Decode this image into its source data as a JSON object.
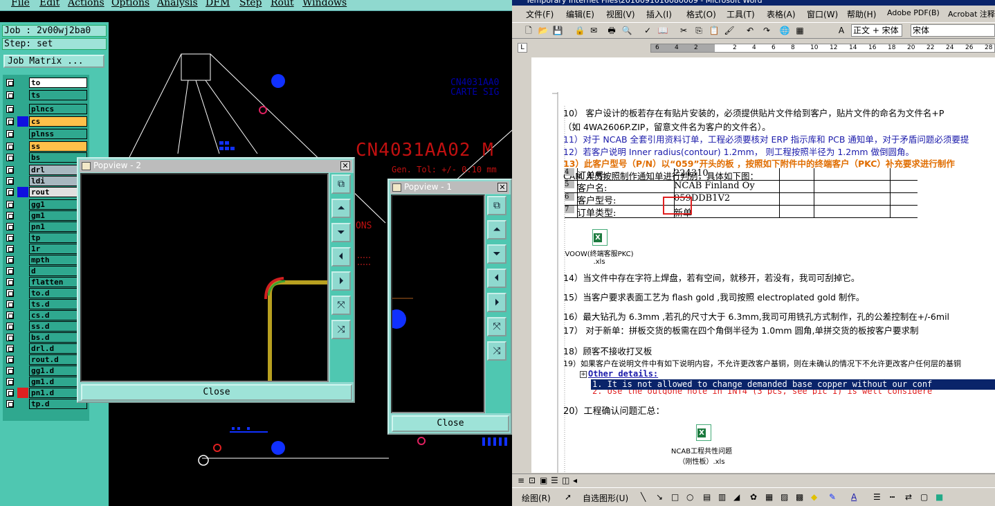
{
  "cam": {
    "menu": [
      "File",
      "Edit",
      "Actions",
      "Options",
      "Analysis",
      "DFM",
      "Step",
      "Rout",
      "Windows"
    ],
    "job": "Job : 2v00wj2ba0",
    "step": "Step: set",
    "job_matrix": "Job Matrix ...",
    "layers": [
      {
        "name": "to",
        "color": "#2fa88f",
        "fill": "#ffffff"
      },
      {
        "name": "ts",
        "color": "#2fa88f",
        "fill": "#2fa88f"
      },
      {
        "name": "plncs",
        "color": "#2fa88f",
        "fill": "#2fa88f"
      },
      {
        "name": "cs",
        "color": "#1010e0",
        "fill": "#ffc04a"
      },
      {
        "name": "plnss",
        "color": "#2fa88f",
        "fill": "#2fa88f"
      },
      {
        "name": "ss",
        "color": "#2fa88f",
        "fill": "#ffc04a"
      },
      {
        "name": "bs",
        "color": "#2fa88f",
        "fill": "#2fa88f"
      },
      {
        "name": "drl",
        "color": "#2fa88f",
        "fill": "#a8b8c0"
      },
      {
        "name": "ldi",
        "color": "#2fa88f",
        "fill": "#a8b8c0"
      },
      {
        "name": "rout",
        "color": "#1010e0",
        "fill": "#e0e0e0"
      },
      {
        "name": "gg1",
        "color": "#2fa88f",
        "fill": "#2fa88f"
      },
      {
        "name": "gm1",
        "color": "#2fa88f",
        "fill": "#2fa88f"
      },
      {
        "name": "pn1",
        "color": "#2fa88f",
        "fill": "#2fa88f"
      },
      {
        "name": "tp",
        "color": "#2fa88f",
        "fill": "#2fa88f"
      },
      {
        "name": "1r",
        "color": "#2fa88f",
        "fill": "#2fa88f"
      },
      {
        "name": "mpth",
        "color": "#2fa88f",
        "fill": "#2fa88f"
      },
      {
        "name": "d",
        "color": "#2fa88f",
        "fill": "#2fa88f"
      },
      {
        "name": "flatten",
        "color": "#2fa88f",
        "fill": "#2fa88f"
      },
      {
        "name": "to.d",
        "color": "#2fa88f",
        "fill": "#2fa88f"
      },
      {
        "name": "ts.d",
        "color": "#2fa88f",
        "fill": "#2fa88f"
      },
      {
        "name": "cs.d",
        "color": "#2fa88f",
        "fill": "#2fa88f"
      },
      {
        "name": "ss.d",
        "color": "#2fa88f",
        "fill": "#2fa88f"
      },
      {
        "name": "bs.d",
        "color": "#2fa88f",
        "fill": "#2fa88f"
      },
      {
        "name": "drl.d",
        "color": "#2fa88f",
        "fill": "#2fa88f"
      },
      {
        "name": "rout.d",
        "color": "#2fa88f",
        "fill": "#2fa88f"
      },
      {
        "name": "gg1.d",
        "color": "#2fa88f",
        "fill": "#2fa88f"
      },
      {
        "name": "gm1.d",
        "color": "#2fa88f",
        "fill": "#2fa88f"
      },
      {
        "name": "pn1.d",
        "color": "#e02020",
        "fill": "#2fa88f"
      },
      {
        "name": "tp.d",
        "color": "#2fa88f",
        "fill": "#2fa88f"
      }
    ],
    "canvas_text": {
      "code_small": "CN4031AA0",
      "carte": "CARTE SIG",
      "code_big": "CN4031AA02 M",
      "tol": "Gen. Tol: +/- 0.10 mm",
      "ons": "ONS"
    },
    "popview2": {
      "title": "Popview - 2",
      "close": "Close"
    },
    "popview1": {
      "title": "Popview - 1",
      "close": "Close"
    }
  },
  "word": {
    "title": "Temporary Internet Files\\2016091016080009 - Microsoft Word",
    "menu": [
      "文件(F)",
      "编辑(E)",
      "视图(V)",
      "插入(I)",
      "格式(O)",
      "工具(T)",
      "表格(A)",
      "窗口(W)",
      "帮助(H)",
      "Adobe PDF(B)",
      "Acrobat 注释"
    ],
    "style": "正文 + 宋体",
    "font": "宋体",
    "ruler": [
      "6",
      "4",
      "2",
      "",
      "2",
      "4",
      "6",
      "8",
      "10",
      "12",
      "14",
      "16",
      "18",
      "20",
      "22",
      "24",
      "26",
      "28"
    ],
    "lines": {
      "l10": "10） 客户设计的板若存在有贴片安装的，必须提供贴片文件给到客户，贴片文件的命名为文件名+P",
      "l10b": "（如 4WA2606P.ZIP，留意文件名为客户的文件名）。",
      "l11": "11）对于 NCAB 全套引用资料订单，工程必须要核对 ERP 指示库和 PCB 通知单，对于矛盾问题必须要提",
      "l12": "12）若客户说明 Inner radius(contour) 1.2mm，  则工程按照半径为 1.2mm 做倒圆角。",
      "l13": "13）此客户型号（P/N）以“059”开头的板 ，按照如下附件中的终端客户（PKC）补充要求进行制作",
      "l13b": "CAM 人员按照制作通知单进行判别，具体如下图：",
      "l14": "14）当文件中存在字符上焊盘，若有空间，就移开，若没有，我司可刮掉它。",
      "l15": "15）当客户要求表面工艺为 flash gold ,我司按照 electroplated gold 制作。",
      "l16": "16）最大钻孔为 6.3mm ,若孔的尺寸大于 6.3mm,我司可用铣孔方式制作，孔的公差控制在+/-6mil",
      "l17": "17） 对于新单：拼板交货的板需在四个角倒半径为 1.0mm 圆角,单拼交货的板按客户要求制",
      "l18": "18）顾客不接收打叉板",
      "l19": "19）如果客户在说明文件中有如下说明内容，不允许更改客户基铜，则在未确认的情况下不允许更改客户任何层的基铜",
      "other": "Other details:",
      "o1": "1. It is not allowed to change demanded base copper without our conf",
      "o2": "2. Use the outgone note in INT4 (3 pcs, see pic 1) is well considere",
      "l20": "20）工程确认问题汇总："
    },
    "table": [
      [
        "4",
        "订单号:",
        "224310"
      ],
      [
        "5",
        "客户名:",
        "NCAB Finland Oy"
      ],
      [
        "6",
        "客户型号:",
        "059DDB1V2"
      ],
      [
        "7",
        "订单类型:",
        "新单"
      ]
    ],
    "obj1": "VOOW(终端客服PKC)\n.xls",
    "obj2": "NCAB工程共性问题\n（刚性板）.xls",
    "draw": [
      "绘图(R)",
      "自选图形(U)"
    ]
  }
}
